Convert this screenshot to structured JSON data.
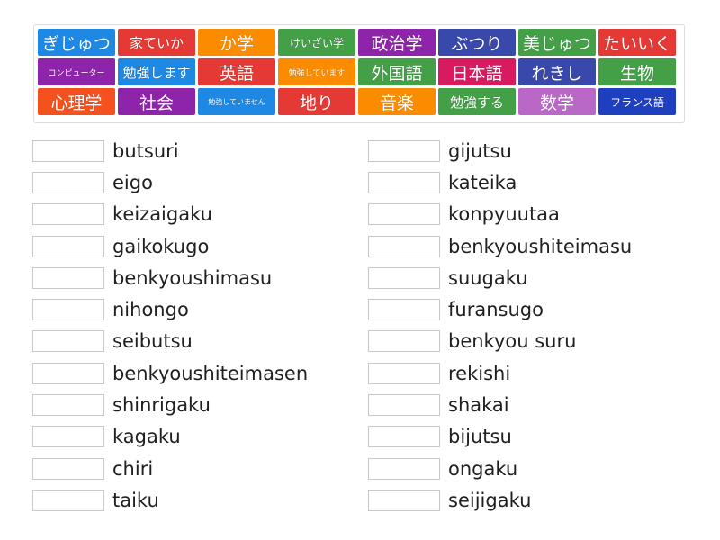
{
  "tiles": [
    {
      "label": "ぎじゅつ",
      "color": "#1e88e5"
    },
    {
      "label": "家ていか",
      "color": "#e53935"
    },
    {
      "label": "か学",
      "color": "#fb8c00"
    },
    {
      "label": "けいざい学",
      "color": "#43a047"
    },
    {
      "label": "政治学",
      "color": "#8e24aa"
    },
    {
      "label": "ぶつり",
      "color": "#3949ab"
    },
    {
      "label": "美じゅつ",
      "color": "#43a047"
    },
    {
      "label": "たいいく",
      "color": "#e53935"
    },
    {
      "label": "コンピューター",
      "color": "#8e24aa"
    },
    {
      "label": "勉強します",
      "color": "#1e88e5"
    },
    {
      "label": "英語",
      "color": "#e53935"
    },
    {
      "label": "勉強しています",
      "color": "#fb8c00"
    },
    {
      "label": "外国語",
      "color": "#43a047"
    },
    {
      "label": "日本語",
      "color": "#d81b60"
    },
    {
      "label": "れきし",
      "color": "#3949ab"
    },
    {
      "label": "生物",
      "color": "#43a047"
    },
    {
      "label": "心理学",
      "color": "#f4511e"
    },
    {
      "label": "社会",
      "color": "#8e24aa"
    },
    {
      "label": "勉強していません",
      "color": "#1e88e5"
    },
    {
      "label": "地り",
      "color": "#e53935"
    },
    {
      "label": "音楽",
      "color": "#fb8c00"
    },
    {
      "label": "勉強する",
      "color": "#43a047"
    },
    {
      "label": "数学",
      "color": "#ba68c8"
    },
    {
      "label": "フランス語",
      "color": "#1e3fbf"
    }
  ],
  "left_column": [
    {
      "romaji": "butsuri"
    },
    {
      "romaji": "eigo"
    },
    {
      "romaji": "keizaigaku"
    },
    {
      "romaji": "gaikokugo"
    },
    {
      "romaji": "benkyoushimasu"
    },
    {
      "romaji": "nihongo"
    },
    {
      "romaji": "seibutsu"
    },
    {
      "romaji": "benkyoushiteimasen"
    },
    {
      "romaji": "shinrigaku"
    },
    {
      "romaji": "kagaku"
    },
    {
      "romaji": "chiri"
    },
    {
      "romaji": "taiku"
    }
  ],
  "right_column": [
    {
      "romaji": "gijutsu"
    },
    {
      "romaji": "kateika"
    },
    {
      "romaji": "konpyuutaa"
    },
    {
      "romaji": "benkyoushiteimasu"
    },
    {
      "romaji": "suugaku"
    },
    {
      "romaji": "furansugo"
    },
    {
      "romaji": "benkyou suru"
    },
    {
      "romaji": "rekishi"
    },
    {
      "romaji": "shakai"
    },
    {
      "romaji": "bijutsu"
    },
    {
      "romaji": "ongaku"
    },
    {
      "romaji": "seijigaku"
    }
  ]
}
